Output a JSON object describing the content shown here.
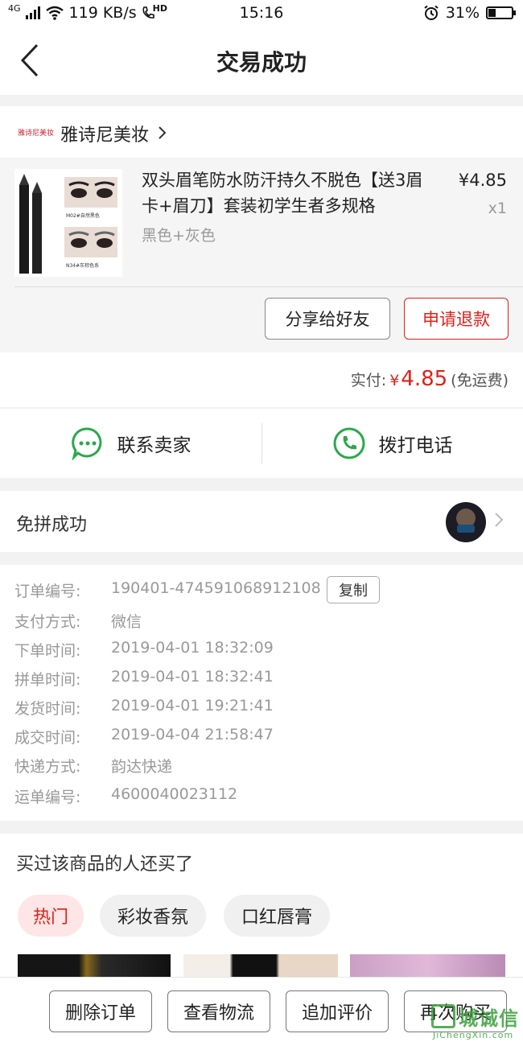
{
  "status_bar": {
    "network": "4G",
    "speed": "119 KB/s",
    "hd": "HD",
    "time": "15:16",
    "battery": "31%",
    "battery_level": 0.31
  },
  "nav": {
    "title": "交易成功"
  },
  "shop": {
    "logo_text": "雅诗尼美妆",
    "name": "雅诗尼美妆"
  },
  "product": {
    "title": "双头眉笔防水防汗持久不脱色【送3眉卡+眉刀】套装初学生者多规格",
    "variant": "黑色+灰色",
    "price": "¥4.85",
    "quantity": "x1",
    "thumb_labels": [
      "M02#自然黑色",
      "N34#灰棕色系"
    ],
    "share_label": "分享给好友",
    "refund_label": "申请退款"
  },
  "payment": {
    "label": "实付:",
    "currency": "¥",
    "amount": "4.85",
    "note": "(免运费)"
  },
  "contact": {
    "seller_label": "联系卖家",
    "phone_label": "拨打电话"
  },
  "group_buy": {
    "label": "免拼成功"
  },
  "order_info": {
    "copy_label": "复制",
    "rows": [
      {
        "key": "订单编号:",
        "value": "190401-474591068912108"
      },
      {
        "key": "支付方式:",
        "value": "微信"
      },
      {
        "key": "下单时间:",
        "value": "2019-04-01 18:32:09"
      },
      {
        "key": "拼单时间:",
        "value": "2019-04-01 18:32:41"
      },
      {
        "key": "发货时间:",
        "value": "2019-04-01 19:21:41"
      },
      {
        "key": "成交时间:",
        "value": "2019-04-04 21:58:47"
      },
      {
        "key": "快递方式:",
        "value": "韵达快递"
      },
      {
        "key": "运单编号:",
        "value": "4600040023112"
      }
    ]
  },
  "recommend": {
    "title": "买过该商品的人还买了",
    "tabs": [
      "热门",
      "彩妆香氛",
      "口红唇膏"
    ]
  },
  "bottom_actions": [
    "删除订单",
    "查看物流",
    "追加评价",
    "再次购买"
  ],
  "watermark": {
    "text": "城诚信",
    "sub": "JiChengXin.com"
  },
  "colors": {
    "accent": "#e0201a",
    "green": "#2aa84a",
    "muted": "#999999"
  }
}
